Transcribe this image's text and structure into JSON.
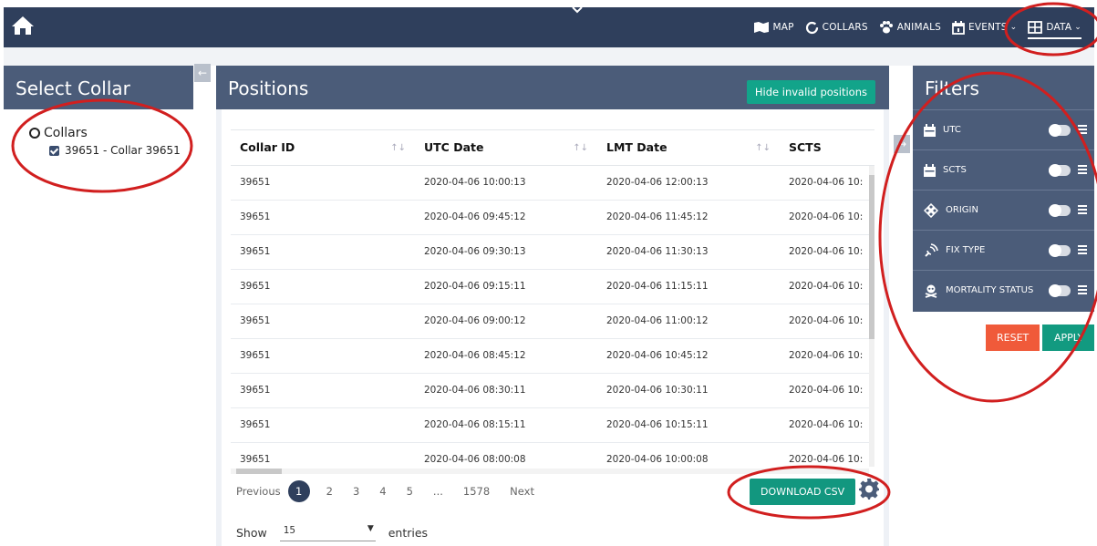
{
  "nav": {
    "items": [
      {
        "label": "MAP",
        "icon": "map-icon"
      },
      {
        "label": "COLLARS",
        "icon": "collar-ring-icon"
      },
      {
        "label": "ANIMALS",
        "icon": "paw-icon"
      },
      {
        "label": "EVENTS",
        "icon": "calendar-icon"
      },
      {
        "label": "DATA",
        "icon": "grid-icon"
      }
    ]
  },
  "left": {
    "title": "Select Collar",
    "collapse_glyph": "←",
    "tree_root": "Collars",
    "tree_child": "39651 - Collar 39651"
  },
  "positions": {
    "title": "Positions",
    "hide_invalid": "Hide invalid positions",
    "columns": [
      "Collar ID",
      "UTC Date",
      "LMT Date",
      "SCTS"
    ],
    "rows": [
      [
        "39651",
        "2020-04-06 10:00:13",
        "2020-04-06 12:00:13",
        "2020-04-06 10:"
      ],
      [
        "39651",
        "2020-04-06 09:45:12",
        "2020-04-06 11:45:12",
        "2020-04-06 10:"
      ],
      [
        "39651",
        "2020-04-06 09:30:13",
        "2020-04-06 11:30:13",
        "2020-04-06 10:"
      ],
      [
        "39651",
        "2020-04-06 09:15:11",
        "2020-04-06 11:15:11",
        "2020-04-06 10:"
      ],
      [
        "39651",
        "2020-04-06 09:00:12",
        "2020-04-06 11:00:12",
        "2020-04-06 10:"
      ],
      [
        "39651",
        "2020-04-06 08:45:12",
        "2020-04-06 10:45:12",
        "2020-04-06 10:"
      ],
      [
        "39651",
        "2020-04-06 08:30:11",
        "2020-04-06 10:30:11",
        "2020-04-06 10:"
      ],
      [
        "39651",
        "2020-04-06 08:15:11",
        "2020-04-06 10:15:11",
        "2020-04-06 10:"
      ],
      [
        "39651",
        "2020-04-06 08:00:08",
        "2020-04-06 10:00:08",
        "2020-04-06 10:"
      ]
    ],
    "pager": {
      "previous": "Previous",
      "pages": [
        "1",
        "2",
        "3",
        "4",
        "5",
        "...",
        "1578"
      ],
      "next": "Next"
    },
    "download": "DOWNLOAD CSV",
    "show_label": "Show",
    "show_value": "15",
    "entries_label": "entries"
  },
  "filters": {
    "title": "Filters",
    "collapse_glyph": "→",
    "items": [
      {
        "label": "UTC",
        "icon": "calendar-icon"
      },
      {
        "label": "SCTS",
        "icon": "calendar-icon"
      },
      {
        "label": "ORIGIN",
        "icon": "origin-icon"
      },
      {
        "label": "FIX TYPE",
        "icon": "satellite-icon"
      },
      {
        "label": "MORTALITY STATUS",
        "icon": "skull-crossbones-icon"
      }
    ],
    "reset": "RESET",
    "apply": "APPLY"
  },
  "colors": {
    "nav": "#2f3f5c",
    "panel_head": "#4b5c79",
    "teal": "#12a48a",
    "reset": "#f05a3a",
    "annotation": "#d11f1f"
  }
}
